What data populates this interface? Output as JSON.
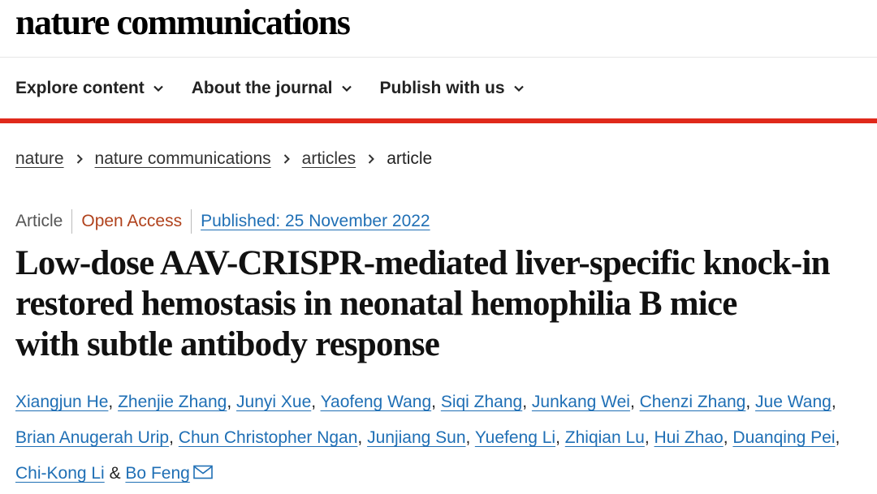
{
  "header": {
    "logo": "nature communications"
  },
  "nav": [
    {
      "label": "Explore content",
      "icon": "chevron-down-icon"
    },
    {
      "label": "About the journal",
      "icon": "chevron-down-icon"
    },
    {
      "label": "Publish with us",
      "icon": "chevron-down-icon"
    }
  ],
  "colors": {
    "accent_bar": "#e0291b",
    "link": "#1f6fb5",
    "open_access": "#b0421c"
  },
  "breadcrumb": {
    "items": [
      "nature",
      "nature communications",
      "articles"
    ],
    "current": "article",
    "separator_icon": "chevron-right-icon"
  },
  "article": {
    "type": "Article",
    "access": "Open Access",
    "published": "Published: 25 November 2022",
    "title_lines": [
      "Low-dose AAV-CRISPR-mediated liver-specific knock-in",
      "restored hemostasis in neonatal hemophilia B mice",
      "with subtle antibody response"
    ],
    "authors": [
      "Xiangjun He",
      "Zhenjie Zhang",
      "Junyi Xue",
      "Yaofeng Wang",
      "Siqi Zhang",
      "Junkang Wei",
      "Chenzi Zhang",
      "Jue Wang",
      "Brian Anugerah Urip",
      "Chun Christopher Ngan",
      "Junjiang Sun",
      "Yuefeng Li",
      "Zhiqian Lu",
      "Hui Zhao",
      "Duanqing Pei",
      "Chi-Kong Li",
      "Bo Feng"
    ],
    "author_separator": ", ",
    "last_author_separator": " & ",
    "corresponding_icon": "mail-icon"
  }
}
